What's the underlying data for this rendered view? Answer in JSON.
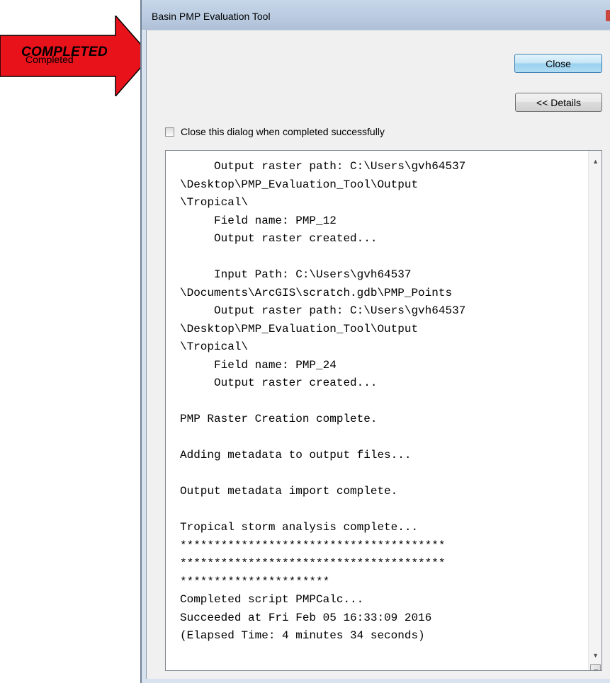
{
  "annotation": {
    "label": "COMPLETED",
    "color": "#e8121b"
  },
  "window": {
    "title": "Basin PMP Evaluation Tool"
  },
  "status": {
    "text": "Completed"
  },
  "buttons": {
    "close": "Close",
    "details": "<< Details"
  },
  "options": {
    "close_on_success": {
      "label": "Close this dialog when completed successfully",
      "checked": false
    }
  },
  "log": {
    "lines": [
      "     Output raster path: C:\\Users\\gvh64537",
      "\\Desktop\\PMP_Evaluation_Tool\\Output",
      "\\Tropical\\",
      "     Field name: PMP_12",
      "     Output raster created...",
      "",
      "     Input Path: C:\\Users\\gvh64537",
      "\\Documents\\ArcGIS\\scratch.gdb\\PMP_Points",
      "     Output raster path: C:\\Users\\gvh64537",
      "\\Desktop\\PMP_Evaluation_Tool\\Output",
      "\\Tropical\\",
      "     Field name: PMP_24",
      "     Output raster created...",
      "",
      "PMP Raster Creation complete.",
      "",
      "Adding metadata to output files...",
      "",
      "Output metadata import complete.",
      "",
      "Tropical storm analysis complete...",
      "***************************************",
      "***************************************",
      "**********************",
      "Completed script PMPCalc...",
      "Succeeded at Fri Feb 05 16:33:09 2016",
      "(Elapsed Time: 4 minutes 34 seconds)"
    ]
  }
}
